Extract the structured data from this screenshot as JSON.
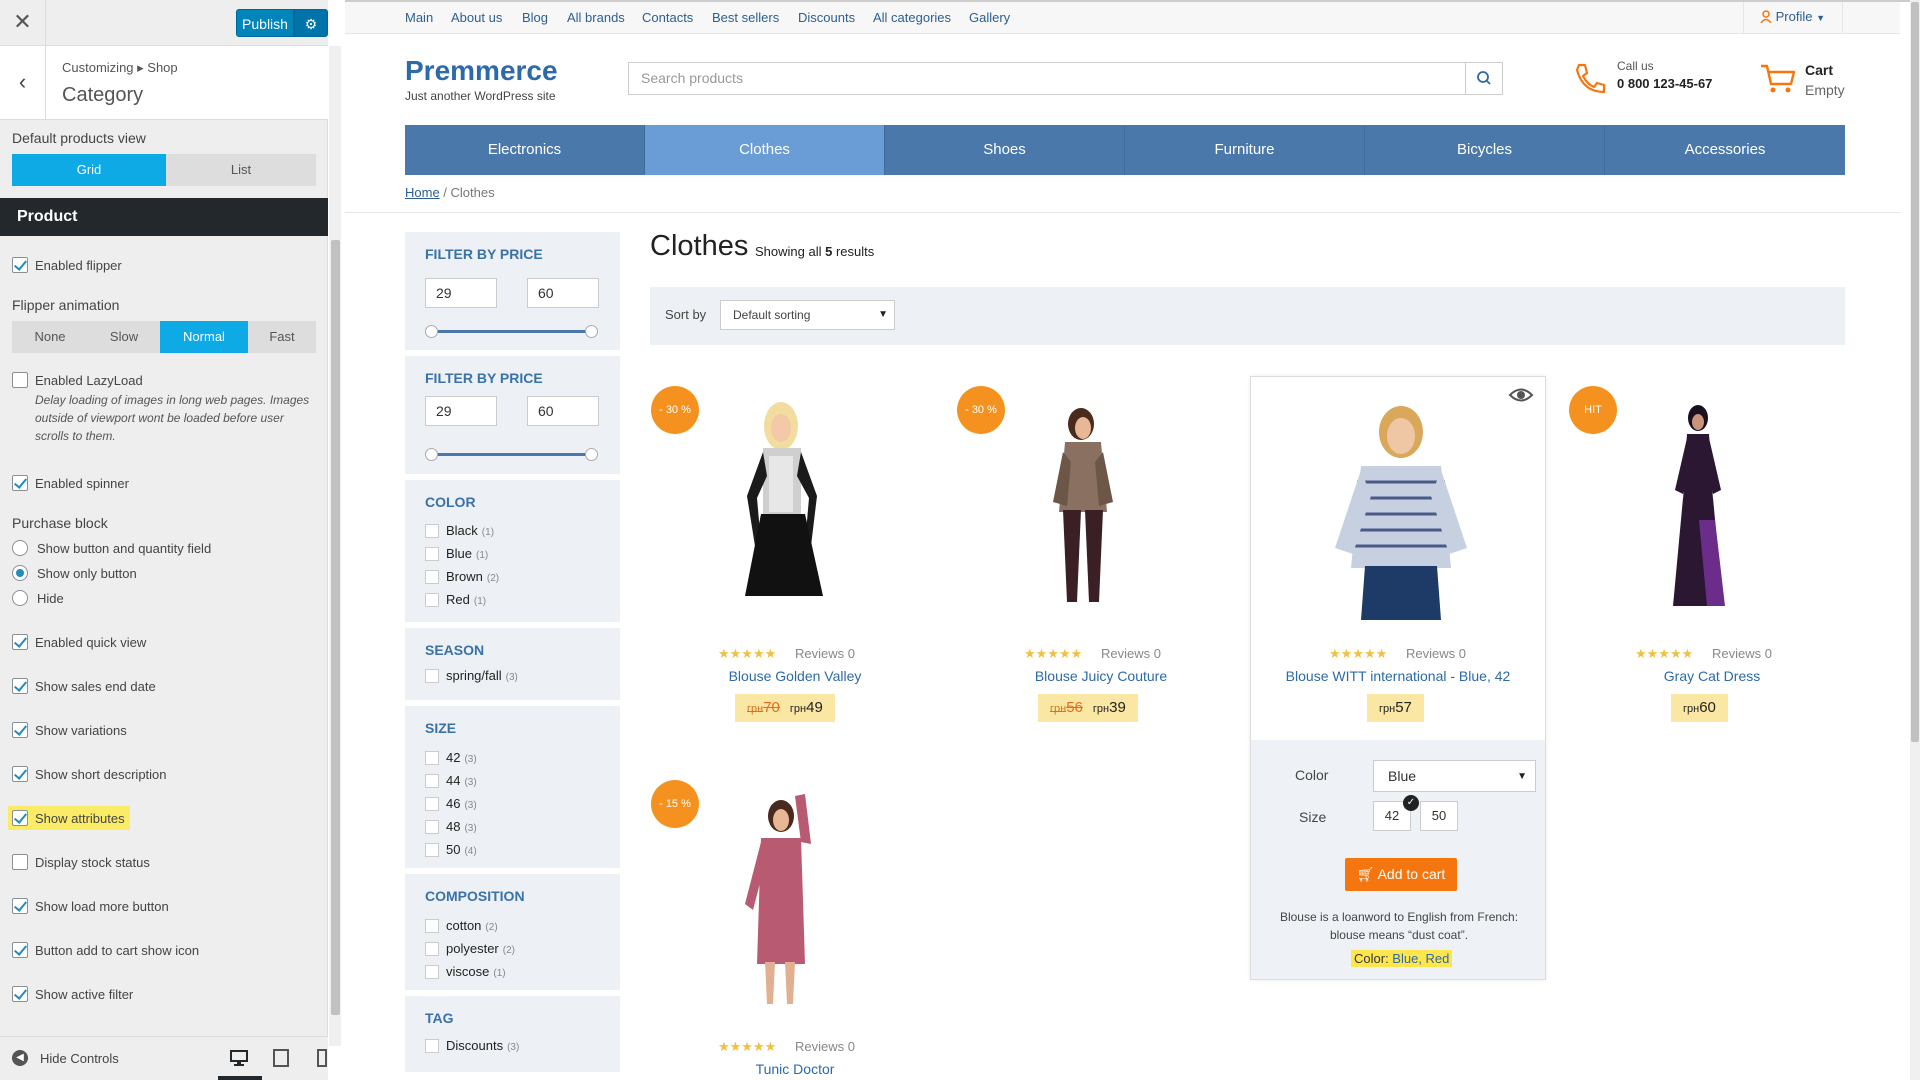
{
  "customizer": {
    "publish_label": "Publish",
    "breadcrumb": "Customizing ▸ Shop",
    "title": "Category",
    "default_view_label": "Default products view",
    "view_options": [
      "Grid",
      "List"
    ],
    "view_selected": "Grid",
    "section_title": "Product",
    "enabled_flipper": "Enabled flipper",
    "flipper_animation_label": "Flipper animation",
    "flipper_options": [
      "None",
      "Slow",
      "Normal",
      "Fast"
    ],
    "flipper_selected": "Normal",
    "lazyload_label": "Enabled LazyLoad",
    "lazyload_desc": "Delay loading of images in long web pages. Images outside of viewport wont be loaded before user scrolls to them.",
    "spinner_label": "Enabled spinner",
    "purchase_block_label": "Purchase block",
    "purchase_options": [
      "Show button and quantity field",
      "Show only button",
      "Hide"
    ],
    "purchase_selected": "Show only button",
    "quick_view_label": "Enabled quick view",
    "sales_end_label": "Show sales end date",
    "variations_label": "Show variations",
    "short_desc_label": "Show short description",
    "attributes_label": "Show attributes",
    "stock_label": "Display stock status",
    "load_more_label": "Show load more button",
    "cart_icon_label": "Button add to cart show icon",
    "active_filter_label": "Show active filter",
    "hide_controls_label": "Hide Controls"
  },
  "site": {
    "topnav": [
      "Main",
      "About us",
      "Blog",
      "All brands",
      "Contacts",
      "Best sellers",
      "Discounts",
      "All categories",
      "Gallery"
    ],
    "profile_label": "Profile",
    "logo": "Premmerce",
    "tagline": "Just another WordPress site",
    "search_placeholder": "Search products",
    "call_label": "Call us",
    "phone": "0 800 123-45-67",
    "cart_label": "Cart",
    "cart_status": "Empty",
    "categories": [
      "Electronics",
      "Clothes",
      "Shoes",
      "Furniture",
      "Bicycles",
      "Accessories"
    ],
    "active_category": "Clothes",
    "breadcrumb_home": "Home",
    "breadcrumb_current": "Clothes"
  },
  "filters": {
    "price1_title": "FILTER BY PRICE",
    "price1_min": "29",
    "price1_max": "60",
    "price2_title": "FILTER BY PRICE",
    "price2_min": "29",
    "price2_max": "60",
    "color_title": "COLOR",
    "colors": [
      {
        "name": "Black",
        "count": "(1)"
      },
      {
        "name": "Blue",
        "count": "(1)"
      },
      {
        "name": "Brown",
        "count": "(2)"
      },
      {
        "name": "Red",
        "count": "(1)"
      }
    ],
    "season_title": "SEASON",
    "seasons": [
      {
        "name": "spring/fall",
        "count": "(3)"
      }
    ],
    "size_title": "SIZE",
    "sizes": [
      {
        "name": "42",
        "count": "(3)"
      },
      {
        "name": "44",
        "count": "(3)"
      },
      {
        "name": "46",
        "count": "(3)"
      },
      {
        "name": "48",
        "count": "(3)"
      },
      {
        "name": "50",
        "count": "(4)"
      }
    ],
    "composition_title": "COMPOSITION",
    "compositions": [
      {
        "name": "cotton",
        "count": "(2)"
      },
      {
        "name": "polyester",
        "count": "(2)"
      },
      {
        "name": "viscose",
        "count": "(1)"
      }
    ],
    "tag_title": "TAG",
    "tags": [
      {
        "name": "Discounts",
        "count": "(3)"
      }
    ]
  },
  "listing": {
    "heading": "Clothes",
    "showing_prefix": "Showing all ",
    "showing_count": "5",
    "showing_suffix": " results",
    "sort_label": "Sort by",
    "sort_value": "Default sorting",
    "reviews_text": "Reviews 0",
    "currency": "грн",
    "products": [
      {
        "name": "Blouse Golden Valley",
        "badge": "- 30 %",
        "old_price": "70",
        "price": "49"
      },
      {
        "name": "Blouse Juicy Couture",
        "badge": "- 30 %",
        "old_price": "56",
        "price": "39"
      },
      {
        "name": "Blouse WITT international - Blue, 42",
        "badge": "",
        "old_price": "",
        "price": "57"
      },
      {
        "name": "Gray Cat Dress",
        "badge": "HIT",
        "old_price": "",
        "price": "60"
      },
      {
        "name": "Tunic Doctor",
        "badge": "- 15 %",
        "old_price": "",
        "price": ""
      }
    ],
    "quick": {
      "color_label": "Color",
      "color_value": "Blue",
      "size_label": "Size",
      "sizes": [
        "42",
        "50"
      ],
      "add_to_cart": "Add to cart",
      "description": "Blouse is a loanword to English from French: blouse means “dust coat”.",
      "attr_label": "Color:",
      "attr_value": " Blue, Red"
    }
  }
}
